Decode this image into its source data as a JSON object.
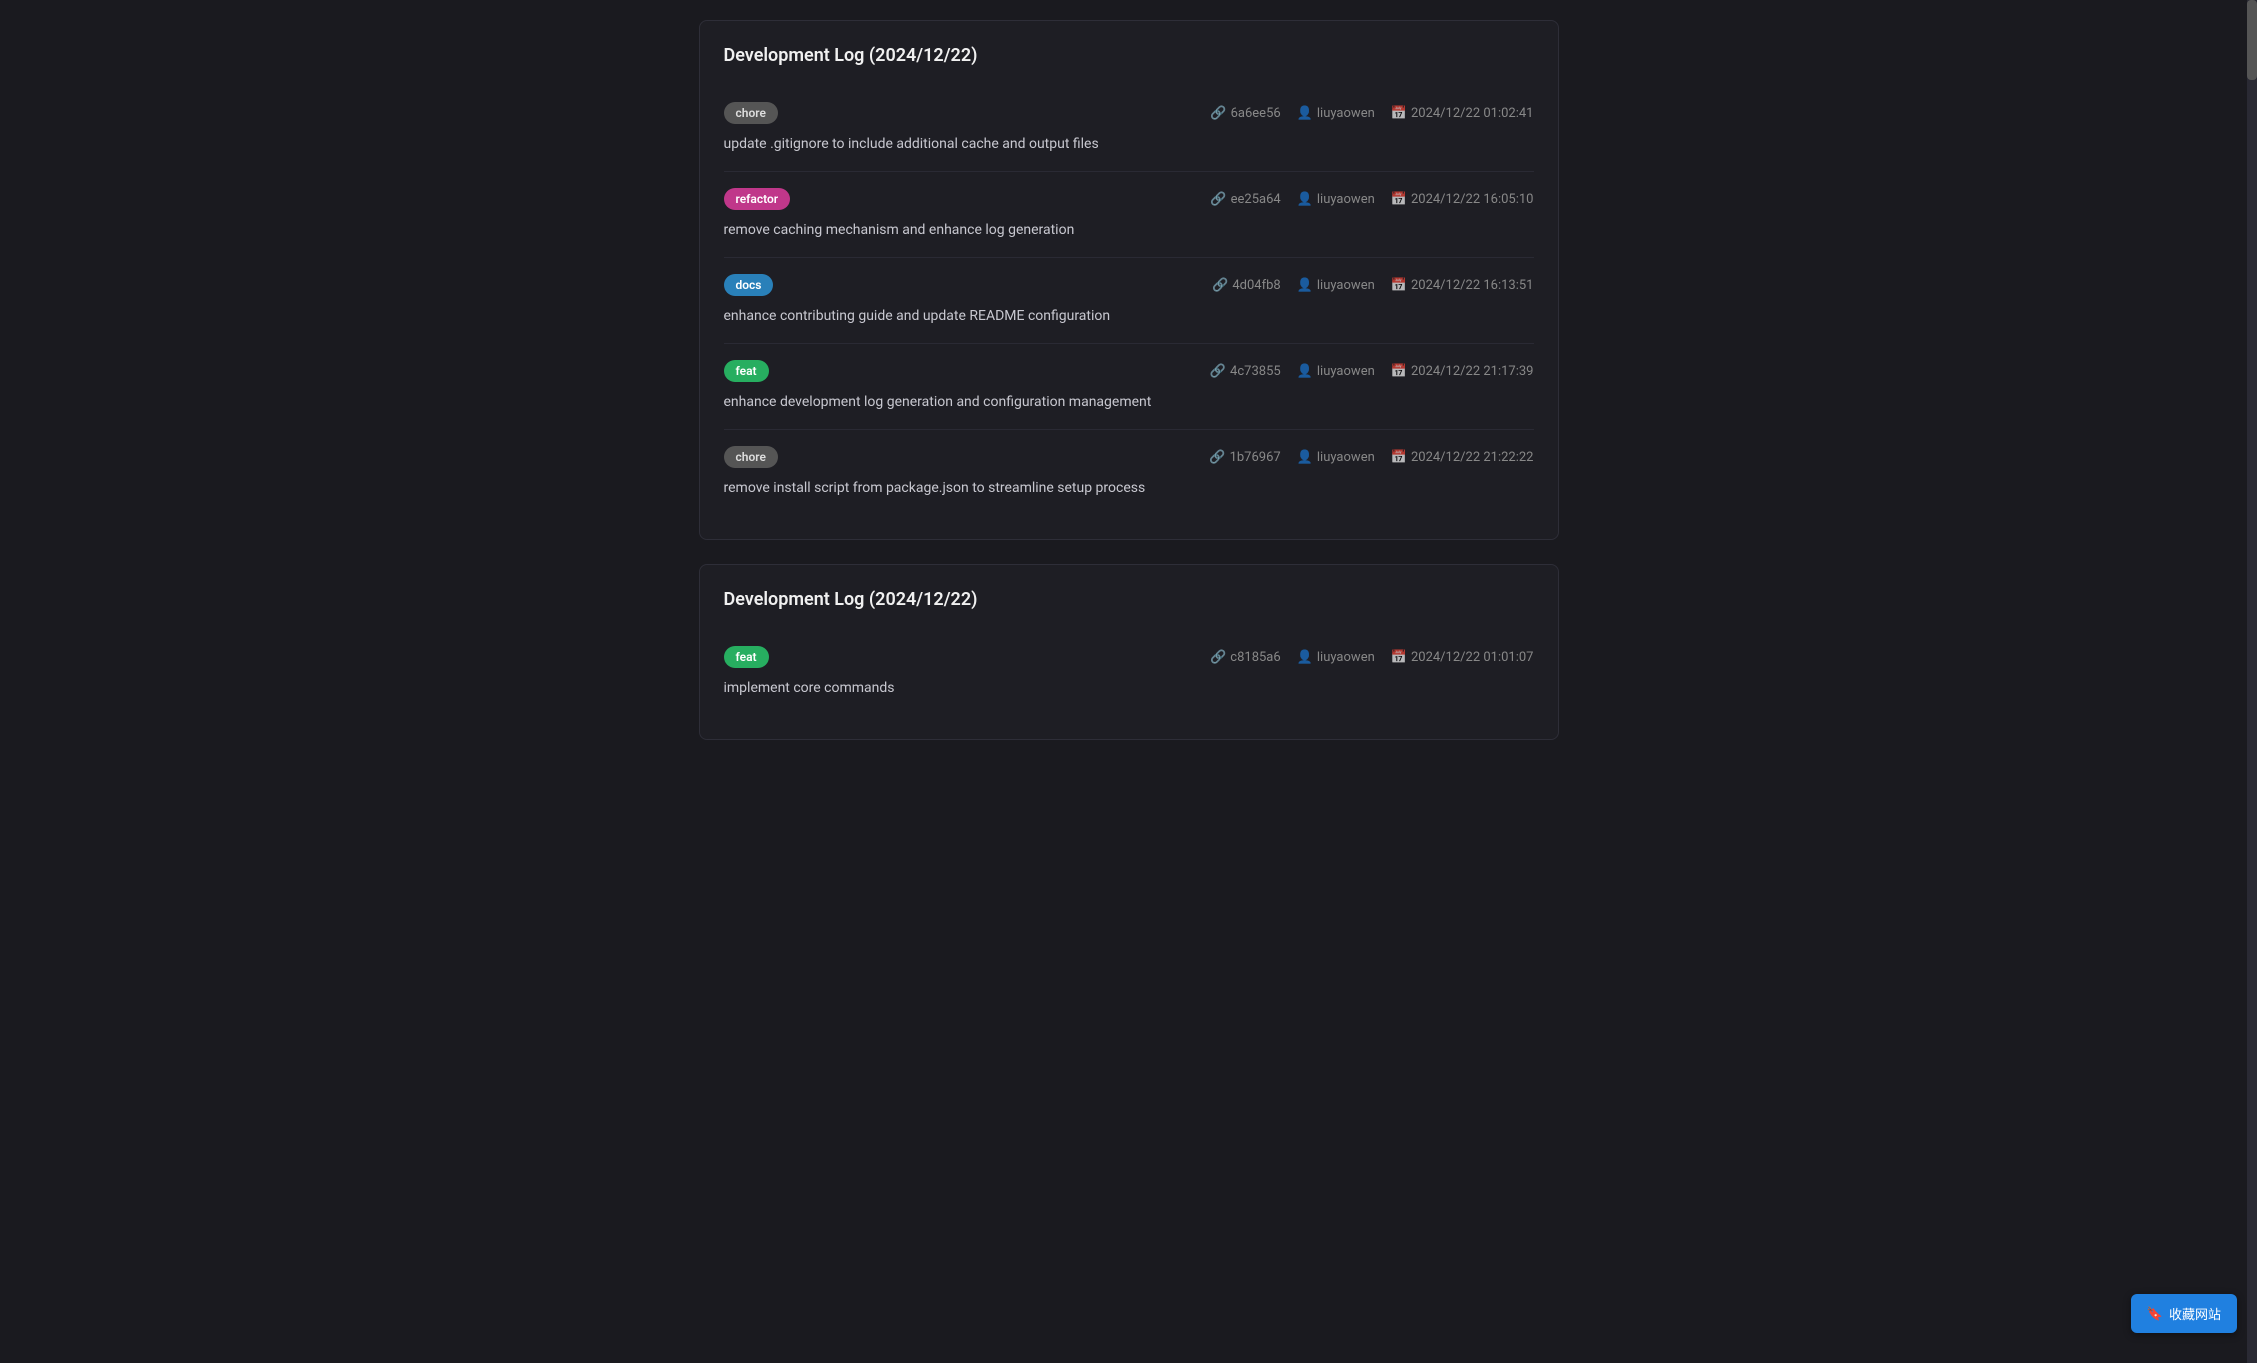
{
  "sections": [
    {
      "title": "Development Log (2024/12/22)",
      "commits": [
        {
          "badge": "chore",
          "badge_type": "chore",
          "hash": "6a6ee56",
          "author": "liuyaowen",
          "date": "2024/12/22 01:02:41",
          "message": "update .gitignore to include additional cache and output files"
        },
        {
          "badge": "refactor",
          "badge_type": "refactor",
          "hash": "ee25a64",
          "author": "liuyaowen",
          "date": "2024/12/22 16:05:10",
          "message": "remove caching mechanism and enhance log generation"
        },
        {
          "badge": "docs",
          "badge_type": "docs",
          "hash": "4d04fb8",
          "author": "liuyaowen",
          "date": "2024/12/22 16:13:51",
          "message": "enhance contributing guide and update README configuration"
        },
        {
          "badge": "feat",
          "badge_type": "feat",
          "hash": "4c73855",
          "author": "liuyaowen",
          "date": "2024/12/22 21:17:39",
          "message": "enhance development log generation and configuration management"
        },
        {
          "badge": "chore",
          "badge_type": "chore",
          "hash": "1b76967",
          "author": "liuyaowen",
          "date": "2024/12/22 21:22:22",
          "message": "remove install script from package.json to streamline setup process"
        }
      ]
    },
    {
      "title": "Development Log (2024/12/22)",
      "commits": [
        {
          "badge": "feat",
          "badge_type": "feat",
          "hash": "c8185a6",
          "author": "liuyaowen",
          "date": "2024/12/22 01:01:07",
          "message": "implement core commands"
        }
      ]
    }
  ],
  "bookmark_button": {
    "label": "收藏网站",
    "icon": "🔖"
  }
}
